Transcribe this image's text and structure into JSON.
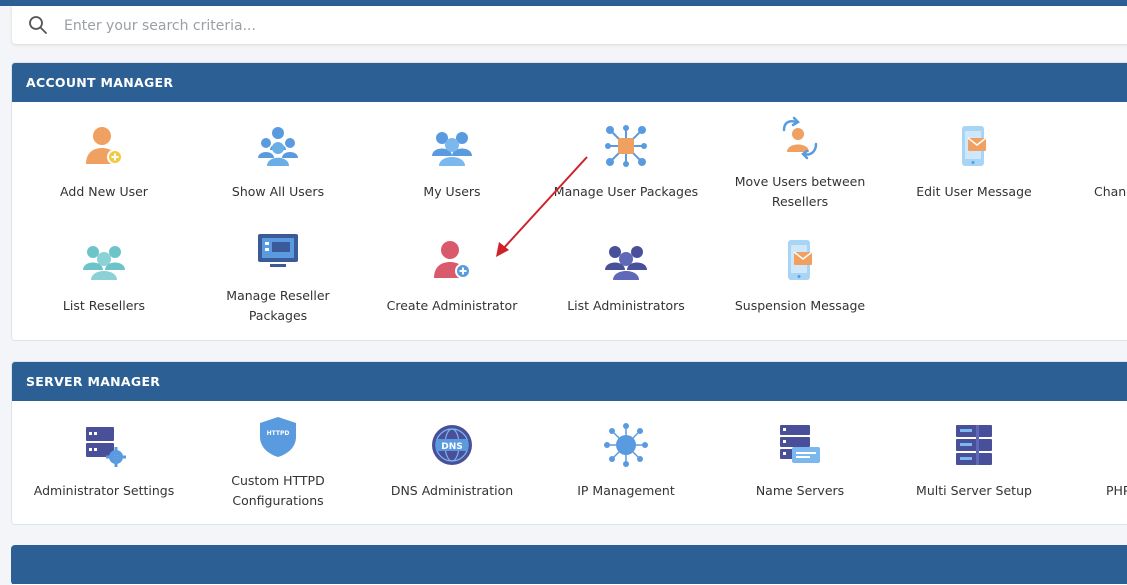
{
  "search": {
    "placeholder": "Enter your search criteria..."
  },
  "account_manager": {
    "title": "ACCOUNT MANAGER",
    "items": [
      {
        "label": "Add New User",
        "icon": "add-user-icon"
      },
      {
        "label": "Show All Users",
        "icon": "users-group-icon"
      },
      {
        "label": "My Users",
        "icon": "my-users-icon"
      },
      {
        "label": "Manage User Packages",
        "icon": "packages-network-icon"
      },
      {
        "label_line1": "Move Users between",
        "label_line2": "Resellers",
        "icon": "move-users-icon"
      },
      {
        "label": "Edit User Message",
        "icon": "phone-message-icon"
      },
      {
        "label": "Chang",
        "icon": ""
      },
      {
        "label": "List Resellers",
        "icon": "resellers-icon"
      },
      {
        "label_line1": "Manage Reseller",
        "label_line2": "Packages",
        "icon": "monitor-icon"
      },
      {
        "label": "Create Administrator",
        "icon": "create-admin-icon"
      },
      {
        "label": "List Administrators",
        "icon": "admins-group-icon"
      },
      {
        "label": "Suspension Message",
        "icon": "suspension-message-icon"
      }
    ]
  },
  "server_manager": {
    "title": "SERVER MANAGER",
    "items": [
      {
        "label": "Administrator Settings",
        "icon": "server-settings-icon"
      },
      {
        "label_line1": "Custom HTTPD",
        "label_line2": "Configurations",
        "icon": "httpd-shield-icon",
        "badge": "HTTPD"
      },
      {
        "label": "DNS Administration",
        "icon": "dns-globe-icon",
        "badge": "DNS"
      },
      {
        "label": "IP Management",
        "icon": "ip-network-icon"
      },
      {
        "label": "Name Servers",
        "icon": "name-servers-icon"
      },
      {
        "label": "Multi Server Setup",
        "icon": "multi-server-icon"
      },
      {
        "label": "PHP C",
        "icon": ""
      }
    ]
  },
  "colors": {
    "header": "#2c5f93",
    "accent_orange": "#f0a060",
    "accent_blue": "#5a9be0",
    "arrow": "#d0202a"
  }
}
